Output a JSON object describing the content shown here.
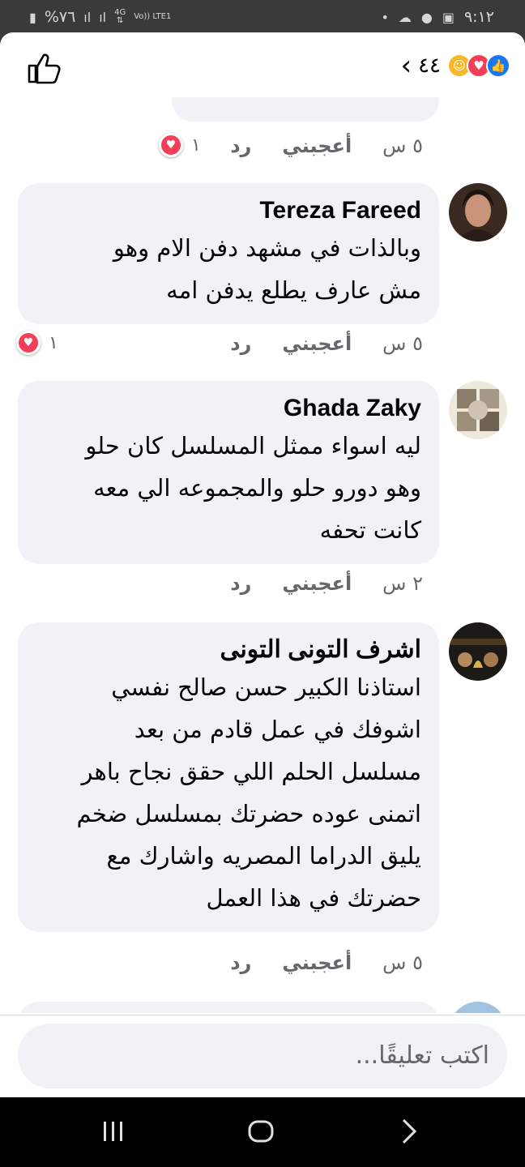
{
  "status_bar": {
    "time": "٩:١٢",
    "battery": "%٧٦",
    "network": "4G",
    "volte": "Vo)) LTE1"
  },
  "header": {
    "reaction_count": "٤٤",
    "reactions": [
      "care-icon",
      "love-icon",
      "like-icon"
    ]
  },
  "comments": [
    {
      "author": "",
      "text": "",
      "time": "٥ س",
      "like_label": "أعجبني",
      "reply_label": "رد",
      "reaction_count": "١"
    },
    {
      "author": "Tereza Fareed",
      "lines": [
        "وبالذات في مشهد دفن الام وهو",
        "مش عارف يطلع يدفن امه"
      ],
      "time": "٥ س",
      "like_label": "أعجبني",
      "reply_label": "رد",
      "reaction_count": "١"
    },
    {
      "author": "Ghada Zaky",
      "lines": [
        "ليه اسواء ممثل المسلسل كان حلو",
        "وهو دورو حلو والمجموعه الي معه",
        "كانت تحفه"
      ],
      "time": "٢ س",
      "like_label": "أعجبني",
      "reply_label": "رد"
    },
    {
      "author": "اشرف التونى التونى",
      "lines": [
        "استاذنا الكبير حسن صالح نفسي",
        "اشوفك في عمل قادم من بعد",
        "مسلسل الحلم اللي حقق نجاح باهر",
        "اتمنى عوده حضرتك بمسلسل ضخم",
        "يليق الدراما المصريه واشارك مع",
        "حضرتك في هذا العمل"
      ],
      "time": "٥ س",
      "like_label": "أعجبني",
      "reply_label": "رد"
    }
  ],
  "composer": {
    "placeholder": "اكتب تعليقًا..."
  }
}
